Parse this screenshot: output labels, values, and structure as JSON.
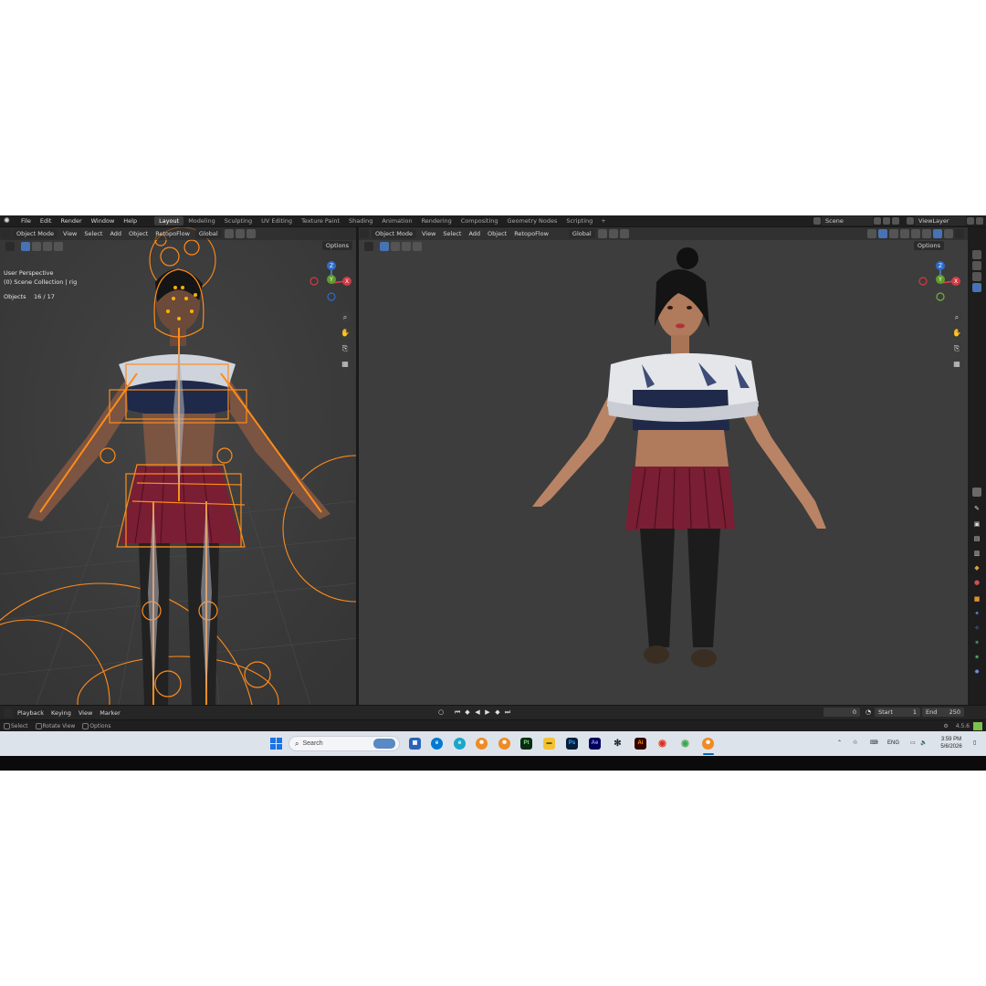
{
  "topbar": {
    "menus": [
      "File",
      "Edit",
      "Render",
      "Window",
      "Help"
    ],
    "workspaces": [
      "Layout",
      "Modeling",
      "Sculpting",
      "UV Editing",
      "Texture Paint",
      "Shading",
      "Animation",
      "Rendering",
      "Compositing",
      "Geometry Nodes",
      "Scripting"
    ],
    "active_workspace": "Layout",
    "add_tab": "+",
    "scene": "Scene",
    "view_layer": "ViewLayer"
  },
  "left_viewport": {
    "mode": "Object Mode",
    "menus": [
      "View",
      "Select",
      "Add",
      "Object"
    ],
    "addon": "RetopoFlow",
    "orientation": "Global",
    "options": "Options",
    "perspective_label": "User Perspective",
    "collection_label": "(0) Scene Collection | rig",
    "objects_label": "Objects",
    "objects_count": "16 / 17",
    "gizmo": {
      "z": "Z",
      "x": "X",
      "y": "Y"
    }
  },
  "right_viewport": {
    "mode": "Object Mode",
    "menus": [
      "View",
      "Select",
      "Add",
      "Object"
    ],
    "addon": "RetopoFlow",
    "orientation": "Global",
    "options": "Options",
    "gizmo": {
      "z": "Z",
      "x": "X",
      "y": "Y"
    }
  },
  "timeline": {
    "menus": [
      "Playback",
      "Keying",
      "View",
      "Marker"
    ],
    "current_frame": "0",
    "start_label": "Start",
    "start": "1",
    "end_label": "End",
    "end": "250"
  },
  "statusbar": {
    "items": [
      "Select",
      "Rotate View",
      "Options"
    ],
    "version": "4.5.6"
  },
  "taskbar": {
    "search_placeholder": "Search",
    "app_labels": [
      "Pt",
      "Ps",
      "Ae",
      "Ai"
    ],
    "lang": "ENG",
    "time": "3:59 PM",
    "date": "5/6/2026"
  },
  "colors": {
    "viewport_bg": "#3d3d3d",
    "rig_orange": "#ff8c1a",
    "active_blue": "#4772b3",
    "skirt": "#7a1e34",
    "top_navy": "#1f2a4a"
  }
}
